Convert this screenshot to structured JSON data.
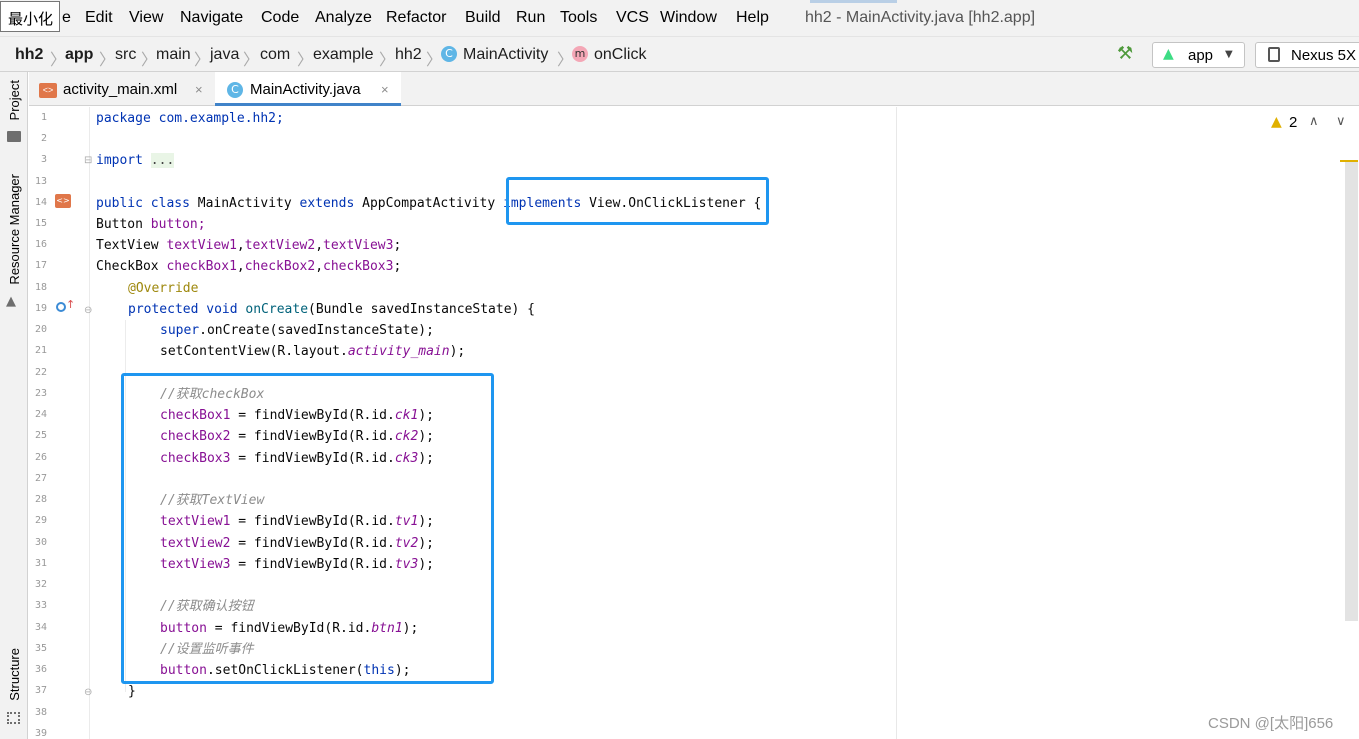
{
  "tooltip": "最小化",
  "menu": [
    "Edit",
    "View",
    "Navigate",
    "Code",
    "Analyze",
    "Refactor",
    "Build",
    "Run",
    "Tools",
    "VCS",
    "Window",
    "Help"
  ],
  "menu_first_partial": "e",
  "window_title": "hh2 - MainActivity.java [hh2.app]",
  "breadcrumbs": [
    "hh2",
    "app",
    "src",
    "main",
    "java",
    "com",
    "example",
    "hh2",
    "MainActivity",
    "onClick"
  ],
  "class_icon": "C",
  "method_icon": "m",
  "run_config": "app",
  "device": "Nexus 5X",
  "tool_windows": {
    "project": "Project",
    "resource_manager": "Resource Manager",
    "structure": "Structure"
  },
  "tabs": [
    {
      "label": "activity_main.xml",
      "icon": "xml-file-icon",
      "close": "×"
    },
    {
      "label": "MainActivity.java",
      "icon": "C",
      "close": "×"
    }
  ],
  "warnings": {
    "count": "2",
    "up": "∧",
    "down": "∨"
  },
  "line_numbers": [
    "1",
    "2",
    "3",
    "13",
    "14",
    "15",
    "16",
    "17",
    "18",
    "19",
    "20",
    "21",
    "22",
    "23",
    "24",
    "25",
    "26",
    "27",
    "28",
    "29",
    "30",
    "31",
    "32",
    "33",
    "34",
    "35",
    "36",
    "37",
    "38",
    "39"
  ],
  "code": {
    "l1": [
      "package com.example.hh2;"
    ],
    "l3": [
      "import ",
      "..."
    ],
    "l14": [
      "public class ",
      "MainActivity ",
      "extends ",
      "AppCompatActivity ",
      "implements ",
      "View.OnClickListener ",
      "{"
    ],
    "l15": [
      "Button ",
      "button;"
    ],
    "l16": [
      "TextView ",
      "textView1",
      ",",
      "textView2",
      ",",
      "textView3",
      ";"
    ],
    "l17": [
      "CheckBox ",
      "checkBox1",
      ",",
      "checkBox2",
      ",",
      "checkBox3",
      ";"
    ],
    "l18": [
      "@Override"
    ],
    "l19": [
      "protected void ",
      "onCreate",
      "(Bundle savedInstanceState) {"
    ],
    "l20": [
      "super",
      ".onCreate(savedInstanceState);"
    ],
    "l21": [
      "setContentView(R.layout.",
      "activity_main",
      ");"
    ],
    "l23": [
      "//获取checkBox"
    ],
    "l24": [
      "checkBox1",
      " = findViewById(R.id.",
      "ck1",
      ");"
    ],
    "l25": [
      "checkBox2",
      " = findViewById(R.id.",
      "ck2",
      ");"
    ],
    "l26": [
      "checkBox3",
      " = findViewById(R.id.",
      "ck3",
      ");"
    ],
    "l28": [
      "//获取TextView"
    ],
    "l29": [
      "textView1",
      " = findViewById(R.id.",
      "tv1",
      ");"
    ],
    "l30": [
      "textView2",
      " = findViewById(R.id.",
      "tv2",
      ");"
    ],
    "l31": [
      "textView3",
      " = findViewById(R.id.",
      "tv3",
      ");"
    ],
    "l33": [
      "//获取确认按钮"
    ],
    "l34": [
      "button",
      " = findViewById(R.id.",
      "btn1",
      ");"
    ],
    "l35": [
      "//设置监听事件"
    ],
    "l36": [
      "button",
      ".setOnClickListener(",
      "this",
      ");"
    ],
    "l37": [
      "}"
    ]
  },
  "watermark": "CSDN @[太阳]656",
  "colors": {
    "highlight_box": "#1e96f0",
    "keyword": "#0033b3",
    "field": "#871094",
    "comment": "#8c8c8c",
    "annotation": "#9e880d"
  }
}
